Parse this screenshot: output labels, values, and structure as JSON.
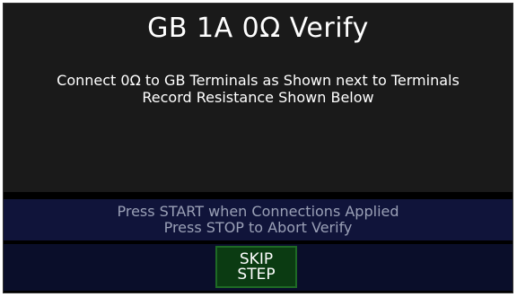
{
  "screen": {
    "title": "GB 1A 0Ω Verify",
    "instruction_line1": "Connect 0Ω to GB Terminals as Shown next to Terminals",
    "instruction_line2": "Record Resistance Shown Below"
  },
  "status": {
    "line1": "Press START when Connections Applied",
    "line2": "Press STOP to Abort Verify"
  },
  "actions": {
    "skip_line1": "SKIP",
    "skip_line2": "STEP"
  }
}
